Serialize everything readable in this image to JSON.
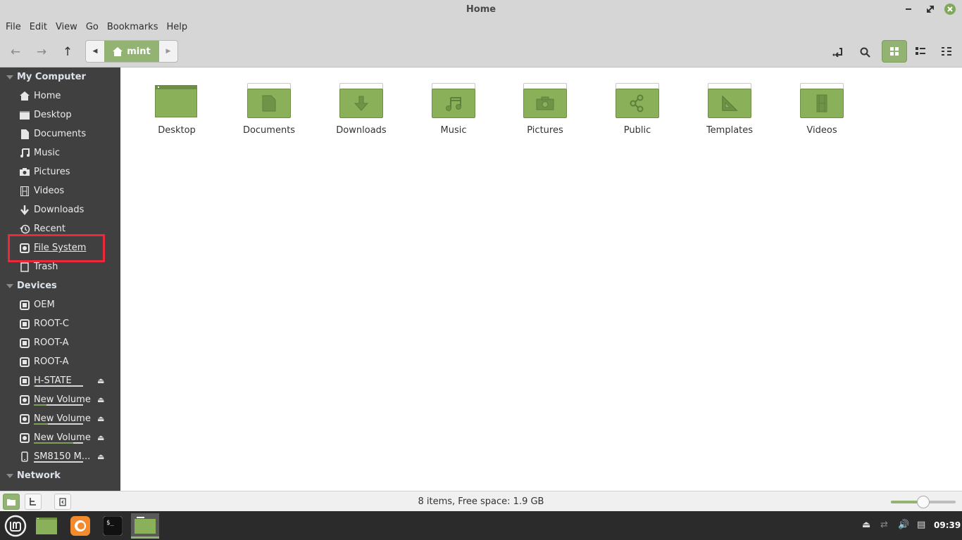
{
  "window": {
    "title": "Home"
  },
  "menubar": [
    "File",
    "Edit",
    "View",
    "Go",
    "Bookmarks",
    "Help"
  ],
  "pathbar": {
    "current": "mint"
  },
  "sidebar": {
    "sections": {
      "my_computer": "My Computer",
      "devices": "Devices",
      "network": "Network"
    },
    "my_computer_items": [
      {
        "label": "Home",
        "icon": "home-icon"
      },
      {
        "label": "Desktop",
        "icon": "desktop-icon"
      },
      {
        "label": "Documents",
        "icon": "document-icon"
      },
      {
        "label": "Music",
        "icon": "music-icon"
      },
      {
        "label": "Pictures",
        "icon": "camera-icon"
      },
      {
        "label": "Videos",
        "icon": "film-icon"
      },
      {
        "label": "Downloads",
        "icon": "download-icon"
      },
      {
        "label": "Recent",
        "icon": "history-icon"
      },
      {
        "label": "File System",
        "icon": "drive-icon"
      },
      {
        "label": "Trash",
        "icon": "trash-icon"
      }
    ],
    "device_items": [
      {
        "label": "OEM",
        "icon": "chip-icon"
      },
      {
        "label": "ROOT-C",
        "icon": "chip-icon"
      },
      {
        "label": "ROOT-A",
        "icon": "chip-icon"
      },
      {
        "label": "ROOT-A",
        "icon": "chip-icon"
      },
      {
        "label": "H-STATE",
        "icon": "chip-icon",
        "usage": 0.03,
        "eject": true
      },
      {
        "label": "New Volume",
        "icon": "drive-icon",
        "usage": 0.25,
        "eject": true
      },
      {
        "label": "New Volume",
        "icon": "drive-icon",
        "usage": 0.28,
        "eject": true
      },
      {
        "label": "New Volume",
        "icon": "drive-icon",
        "usage": 0.8,
        "eject": true
      },
      {
        "label": "SM8150 M...",
        "icon": "phone-icon",
        "usage": 0.0,
        "eject": true
      }
    ]
  },
  "folders": [
    {
      "label": "Desktop",
      "icon": "desktop"
    },
    {
      "label": "Documents",
      "icon": "document"
    },
    {
      "label": "Downloads",
      "icon": "download"
    },
    {
      "label": "Music",
      "icon": "music"
    },
    {
      "label": "Pictures",
      "icon": "camera"
    },
    {
      "label": "Public",
      "icon": "share"
    },
    {
      "label": "Templates",
      "icon": "triangle"
    },
    {
      "label": "Videos",
      "icon": "film"
    }
  ],
  "status": {
    "text": "8 items, Free space: 1.9 GB",
    "zoom_level": 0.5
  },
  "taskbar": {
    "clock": "09:39"
  },
  "colors": {
    "accent": "#92b372",
    "highlight": "#ec2839"
  }
}
